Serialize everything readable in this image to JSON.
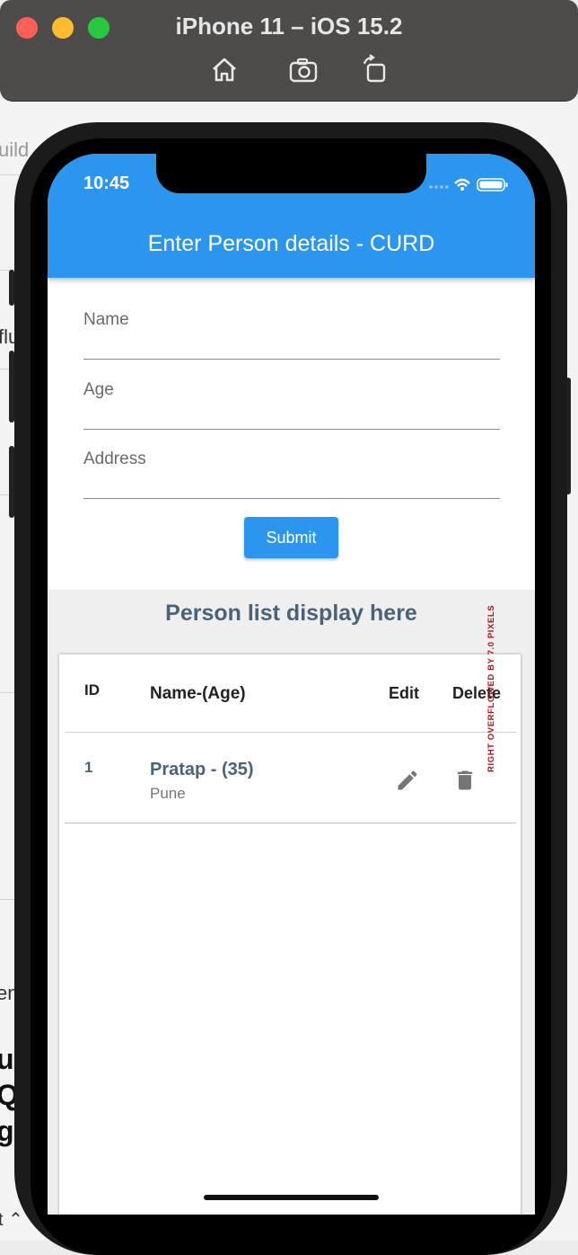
{
  "simulator": {
    "title": "iPhone 11 – iOS 15.2",
    "tools": [
      "home-icon",
      "screenshot-icon",
      "rotate-icon"
    ]
  },
  "background_fragments": {
    "build": "uild",
    "flu": "flu",
    "en": "en",
    "bold1": "ur",
    "bold2": "QI",
    "bold3": "ge",
    "select": "t ⌃"
  },
  "status_bar": {
    "time": "10:45"
  },
  "app_bar": {
    "title": "Enter Person details - CURD",
    "color": "#2c96ef"
  },
  "form": {
    "name_placeholder": "Name",
    "age_placeholder": "Age",
    "address_placeholder": "Address",
    "submit_label": "Submit"
  },
  "list": {
    "heading": "Person list display here",
    "columns": {
      "id": "ID",
      "name_age": "Name-(Age)",
      "edit": "Edit",
      "delete": "Delete"
    },
    "rows": [
      {
        "id": "1",
        "name_age": "Pratap - (35)",
        "address": "Pune"
      }
    ],
    "overflow_warning": "RIGHT OVERFLOWED BY 7.0 PIXELS"
  }
}
